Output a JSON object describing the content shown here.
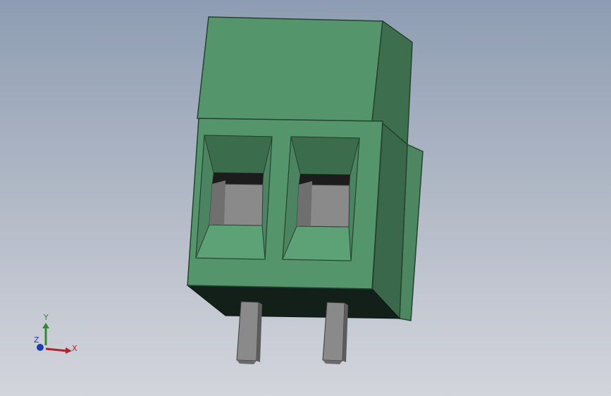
{
  "viewport": {
    "background_top": "#8e9db3",
    "background_bottom": "#d3d5dc"
  },
  "model": {
    "part": "terminal-block-2-pole",
    "body_color": "#55956b",
    "pin_color": "#8a8a8a"
  },
  "triad": {
    "x_label": "X",
    "y_label": "Y",
    "z_label": "Z",
    "x_color": "#b0232a",
    "y_color": "#2e8b2e",
    "z_color": "#1e3bb0"
  }
}
